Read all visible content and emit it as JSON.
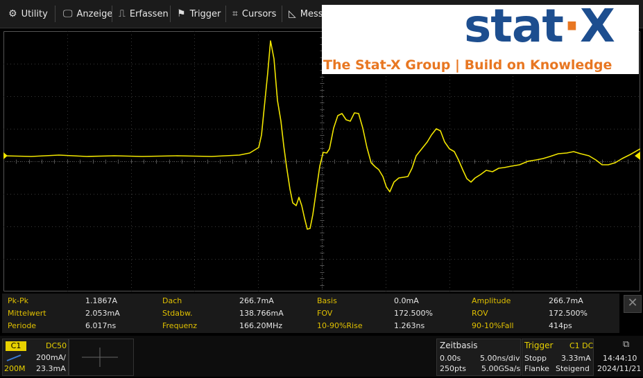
{
  "menu": {
    "utility": "Utility",
    "display": "Anzeige",
    "acquire": "Erfassen",
    "trigger": "Trigger",
    "cursors": "Cursors",
    "measure": "Messe"
  },
  "logo": {
    "wordmark_left": "stat",
    "wordmark_dot": "·",
    "wordmark_right": "X",
    "tagline": "The Stat-X Group | Build on Knowledge"
  },
  "measurements": [
    {
      "label": "Pk-Pk",
      "value": "1.1867A"
    },
    {
      "label": "Dach",
      "value": "266.7mA"
    },
    {
      "label": "Basis",
      "value": "0.0mA"
    },
    {
      "label": "Amplitude",
      "value": "266.7mA"
    },
    {
      "label": "Mittelwert",
      "value": "2.053mA"
    },
    {
      "label": "Stdabw.",
      "value": "138.766mA"
    },
    {
      "label": "FOV",
      "value": "172.500%"
    },
    {
      "label": "ROV",
      "value": "172.500%"
    },
    {
      "label": "Periode",
      "value": "6.017ns"
    },
    {
      "label": "Frequenz",
      "value": "166.20MHz"
    },
    {
      "label": "10-90%Rise",
      "value": "1.263ns"
    },
    {
      "label": "90-10%Fall",
      "value": "414ps"
    }
  ],
  "channel": {
    "name": "C1",
    "coupling": "DC50",
    "scale": "200mA/",
    "bandwidth": "200M",
    "offset": "23.3mA"
  },
  "timebase": {
    "title": "Zeitbasis",
    "delay": "0.00s",
    "scale": "5.00ns/div",
    "points": "250pts",
    "sample_rate": "5.00GSa/s"
  },
  "trigger": {
    "title": "Trigger",
    "source": "C1 DC",
    "state": "Stopp",
    "level": "3.33mA",
    "type": "Flanke",
    "slope": "Steigend"
  },
  "clock": {
    "time": "14:44:10",
    "date": "2024/11/21"
  },
  "colors": {
    "trace": "#f2e600",
    "grid": "#3a3a3a",
    "accent": "#e8d100"
  }
}
